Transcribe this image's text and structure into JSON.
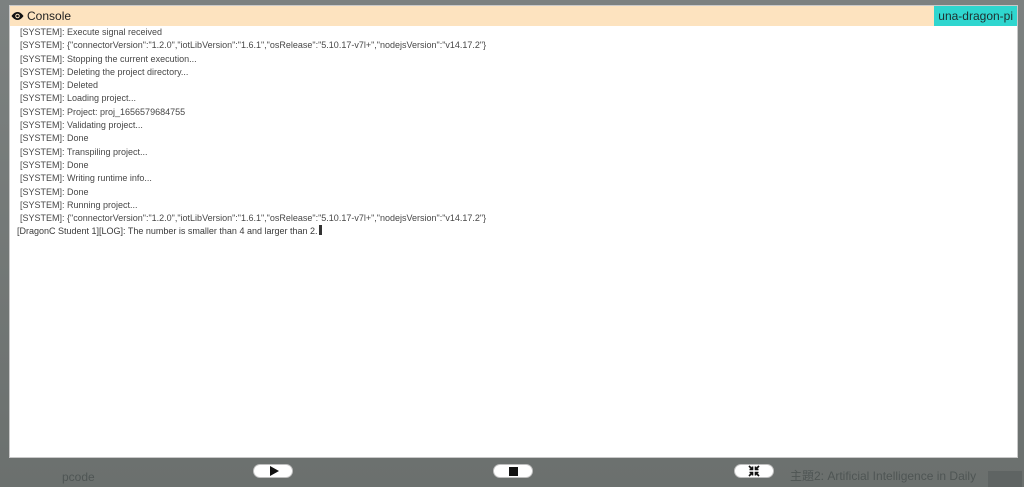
{
  "console": {
    "title": "Console",
    "device": "una-dragon-pi",
    "logs": [
      "[SYSTEM]: Execute signal received",
      "[SYSTEM]: {\"connectorVersion\":\"1.2.0\",\"iotLibVersion\":\"1.6.1\",\"osRelease\":\"5.10.17-v7l+\",\"nodejsVersion\":\"v14.17.2\"}",
      "[SYSTEM]: Stopping the current execution...",
      "[SYSTEM]: Deleting the project directory...",
      "[SYSTEM]: Deleted",
      "[SYSTEM]: Loading project...",
      "[SYSTEM]: Project: proj_1656579684755",
      "[SYSTEM]: Validating project...",
      "[SYSTEM]: Done",
      "[SYSTEM]: Transpiling project...",
      "[SYSTEM]: Done",
      "[SYSTEM]: Writing runtime info...",
      "[SYSTEM]: Done",
      "[SYSTEM]: Running project...",
      "[SYSTEM]: {\"connectorVersion\":\"1.2.0\",\"iotLibVersion\":\"1.6.1\",\"osRelease\":\"5.10.17-v7l+\",\"nodejsVersion\":\"v14.17.2\"}"
    ],
    "user_log": "[DragonC Student 1][LOG]: The number is smaller than 4 and larger than 2."
  },
  "background": {
    "bottom_left": "pcode",
    "bottom_right": "主題2: Artificial Intelligence in Daily"
  },
  "icons": {
    "header": "eye-icon",
    "play": "play-icon",
    "stop": "stop-icon",
    "collapse": "collapse-icon"
  },
  "colors": {
    "header_bg": "#fde3bf",
    "device_badge": "#2fd6cf"
  }
}
